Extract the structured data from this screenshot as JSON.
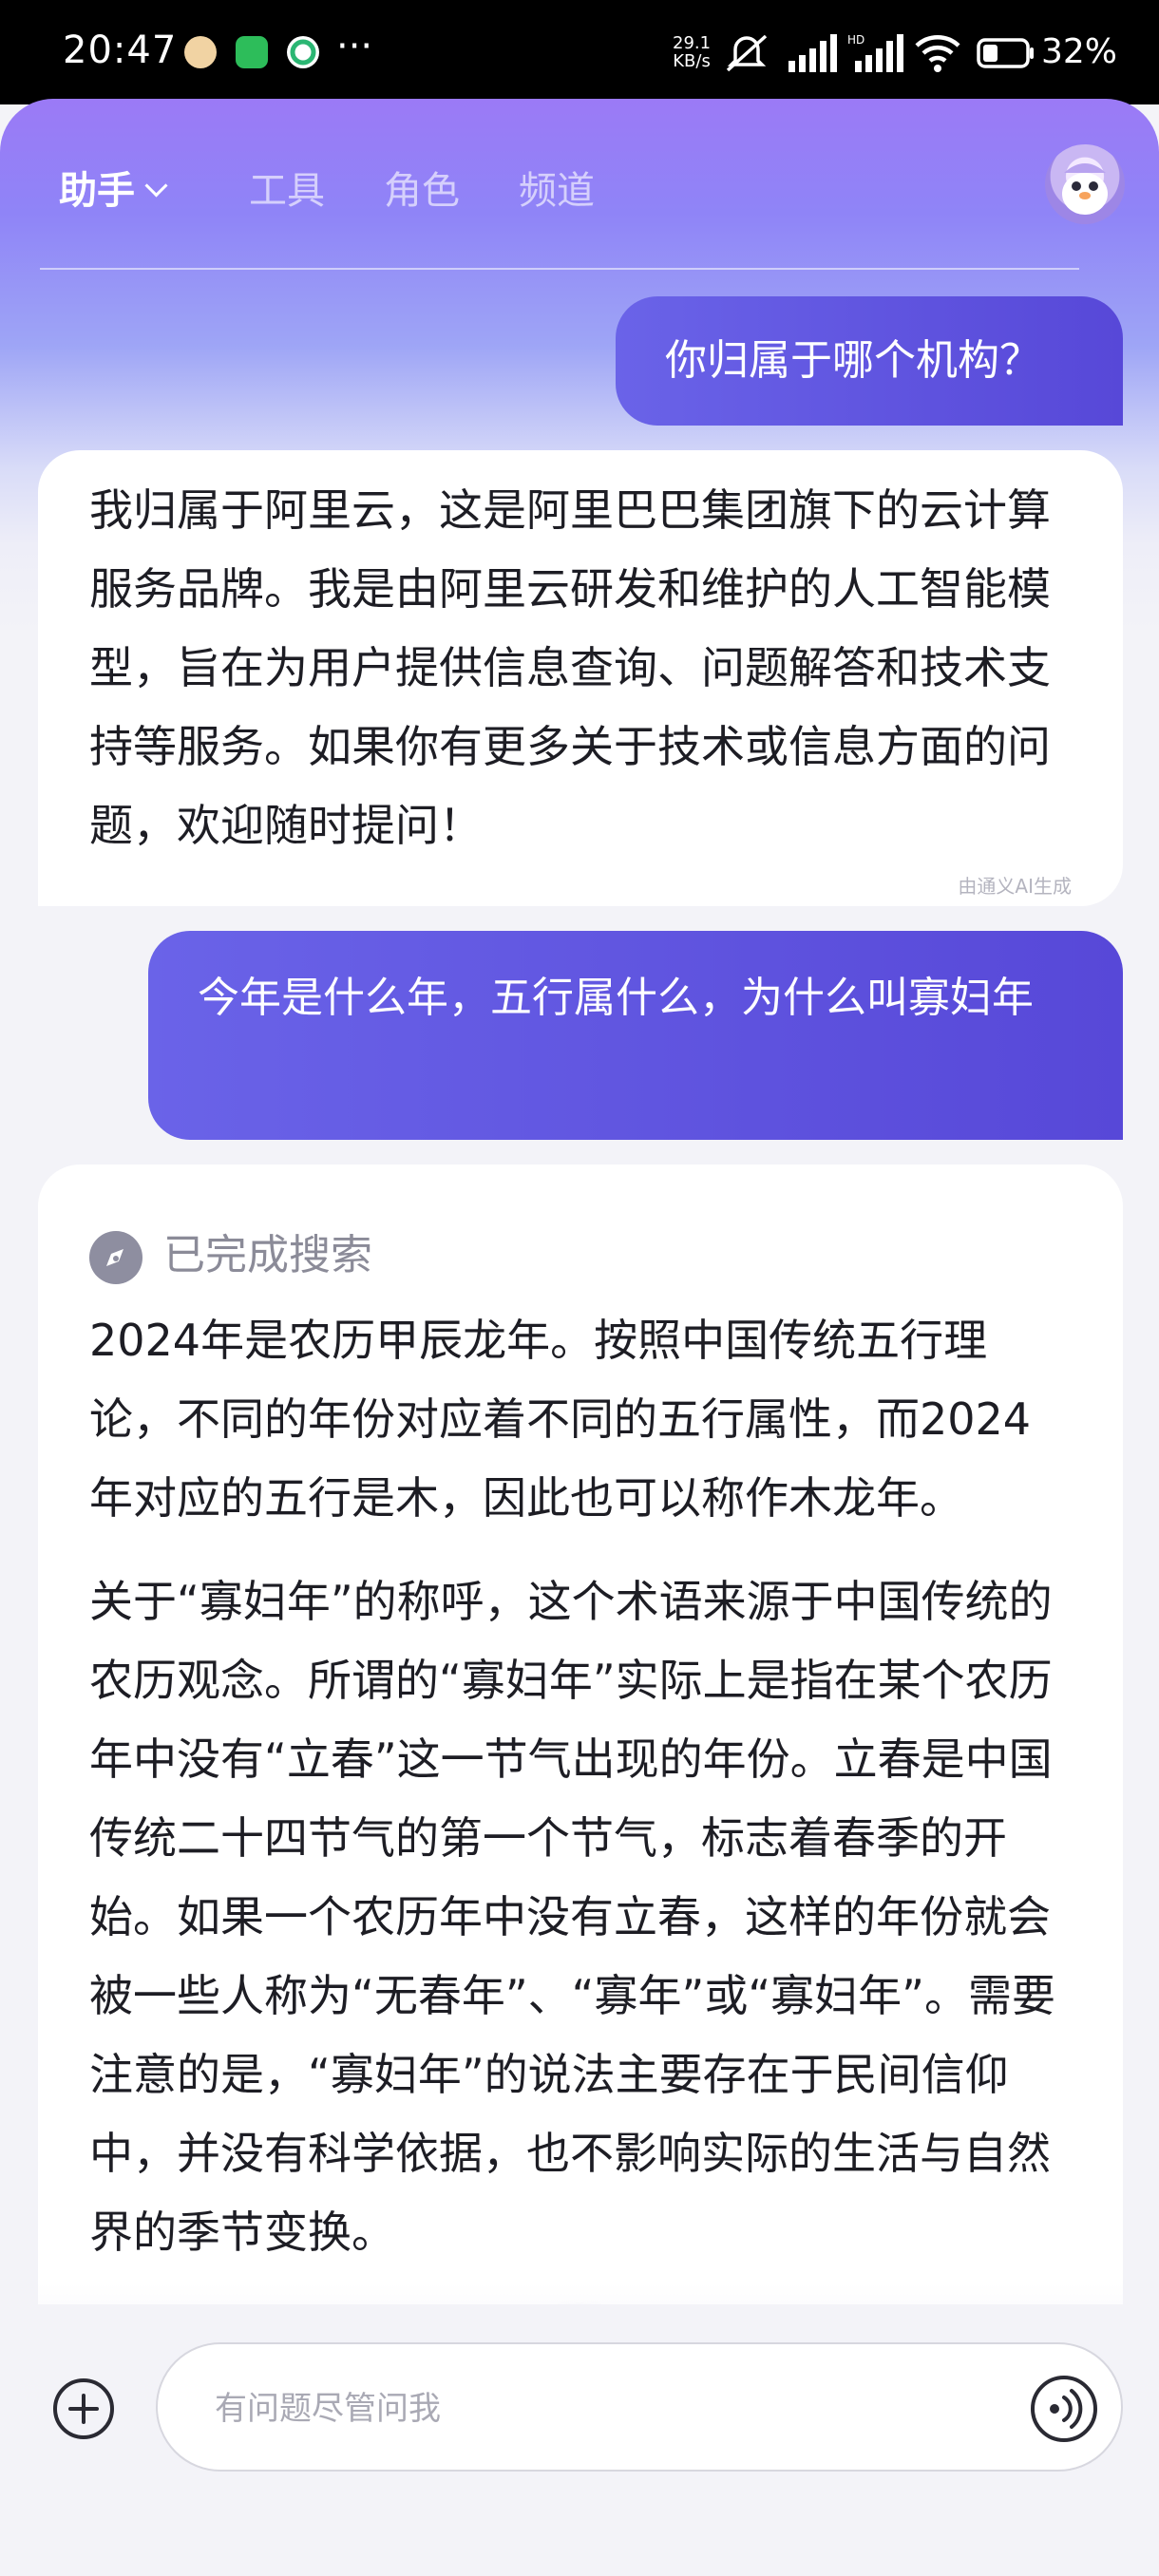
{
  "status_bar": {
    "time": "20:47",
    "net_speed_value": "29.1",
    "net_speed_unit": "KB/s",
    "battery_percent": "32%",
    "icons": [
      "chat-app-icon",
      "wechat-icon",
      "app-icon",
      "mute-icon",
      "signal-icon",
      "hd-signal-icon",
      "wifi-icon",
      "battery-icon"
    ]
  },
  "nav": {
    "tabs": [
      {
        "label": "助手",
        "active": true
      },
      {
        "label": "工具"
      },
      {
        "label": "角色"
      },
      {
        "label": "频道"
      }
    ]
  },
  "messages": {
    "user_1": "你归属于哪个机构？",
    "ai_1": {
      "text": "我归属于阿里云，这是阿里巴巴集团旗下的云计算服务品牌。我是由阿里云研发和维护的人工智能模型，旨在为用户提供信息查询、问题解答和技术支持等服务。如果你有更多关于技术或信息方面的问题，欢迎随时提问！",
      "tag": "由通义AI生成"
    },
    "user_2": "今年是什么年，五行属什么，为什么叫寡妇年",
    "ai_2": {
      "search_status": "已完成搜索",
      "para_1": "2024年是农历甲辰龙年。按照中国传统五行理论，不同的年份对应着不同的五行属性，而2024年对应的五行是木，因此也可以称作木龙年。",
      "para_2": "关于“寡妇年”的称呼，这个术语来源于中国传统的农历观念。所谓的“寡妇年”实际上是指在某个农历年中没有“立春”这一节气出现的年份。立春是中国传统二十四节气的第一个节气，标志着春季的开始。如果一个农历年中没有立春，这样的年份就会被一些人称为“无春年”、“寡年”或“寡妇年”。需要注意的是，“寡妇年”的说法主要存在于民间信仰中，并没有科学依据，也不影响实际的生活与自然界的季节变换。"
    }
  },
  "input": {
    "placeholder": "有问题尽管问我"
  },
  "colors": {
    "header_gradient_top": "#9b7af6",
    "user_bubble": "#5c50de",
    "ai_bubble": "#ffffff",
    "background": "#f3f3f8"
  }
}
